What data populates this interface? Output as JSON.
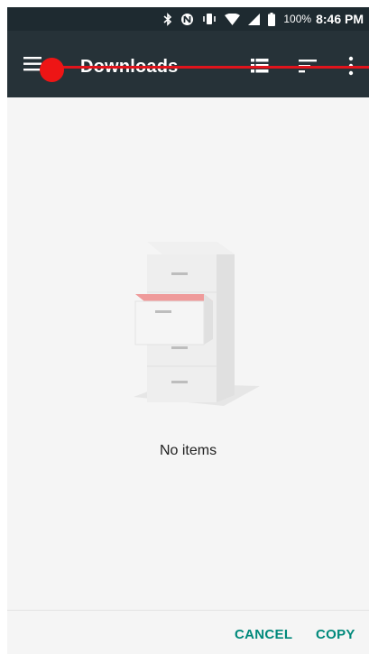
{
  "status_bar": {
    "battery_percent": "100%",
    "time": "8:46 PM",
    "icons": [
      "bluetooth-icon",
      "nfc-icon",
      "vibrate-icon",
      "wifi-icon",
      "signal-icon",
      "battery-icon"
    ]
  },
  "toolbar": {
    "title": "Downloads",
    "icons": [
      "hamburger-menu-icon",
      "list-view-icon",
      "sort-icon",
      "more-vert-icon"
    ]
  },
  "empty_state": {
    "message": "No items",
    "illustration": "file-cabinet-illustration"
  },
  "actions": {
    "cancel_label": "CANCEL",
    "copy_label": "COPY"
  },
  "colors": {
    "toolbar_bg": "#263238",
    "status_bar_bg": "#1e2a30",
    "accent": "#00897b",
    "overlay_red": "#e0141c"
  }
}
